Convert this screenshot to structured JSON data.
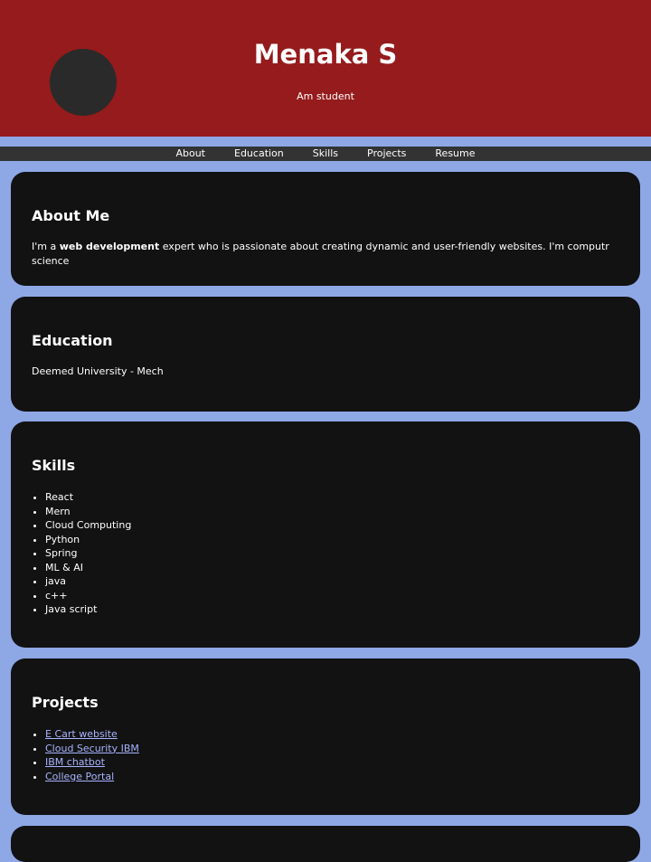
{
  "header": {
    "name": "Menaka S",
    "tagline": "Am student"
  },
  "nav": {
    "items": [
      "About",
      "Education",
      "Skills",
      "Projects",
      "Resume"
    ]
  },
  "about": {
    "heading": "About Me",
    "text_before": "I'm a ",
    "text_bold": "web development",
    "text_after": " expert who is passionate about creating dynamic and user-friendly websites. I'm computr science"
  },
  "education": {
    "heading": "Education",
    "text": "Deemed University - Mech"
  },
  "skills": {
    "heading": "Skills",
    "items": [
      "React",
      "Mern",
      "Cloud Computing",
      "Python",
      "Spring",
      "ML & AI",
      "java",
      "c++",
      "Java script"
    ]
  },
  "projects": {
    "heading": "Projects",
    "items": [
      "E Cart website",
      "Cloud Security IBM",
      "IBM chatbot",
      "College Portal"
    ]
  },
  "colors": {
    "header_bg": "#951b1c",
    "page_bg": "#8ea8e6",
    "card_bg": "#121212",
    "nav_bg": "#333333",
    "link": "#a8b4ff"
  }
}
